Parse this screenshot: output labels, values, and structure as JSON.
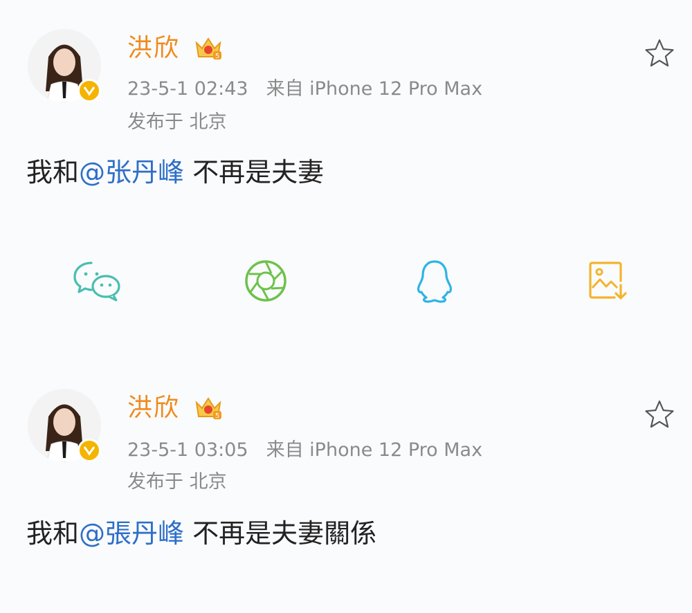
{
  "posts": [
    {
      "author": "洪欣",
      "time": "23-5-1 02:43",
      "source": "来自 iPhone 12 Pro Max",
      "location": "发布于 北京",
      "text_before": "我和",
      "mention": "@张丹峰",
      "text_after": " 不再是夫妻"
    },
    {
      "author": "洪欣",
      "time": "23-5-1 03:05",
      "source": "来自 iPhone 12 Pro Max",
      "location": "发布于 北京",
      "text_before": "我和",
      "mention": "@張丹峰",
      "text_after": " 不再是夫妻關係"
    }
  ],
  "share_icons": [
    "wechat-icon",
    "moments-icon",
    "qq-icon",
    "save-image-icon"
  ],
  "colors": {
    "name": "#f08a1c",
    "meta": "#8a8a8a",
    "mention": "#2e6fc7",
    "badge": "#f4b400",
    "wechat": "#48bfae",
    "moments": "#6cc24a",
    "qq": "#2fb3e6",
    "save": "#f3b42c"
  }
}
